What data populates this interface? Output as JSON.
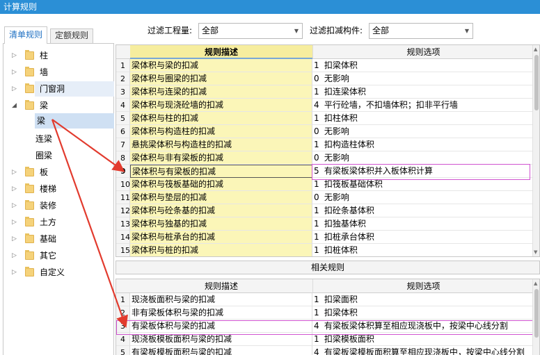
{
  "window": {
    "title": "计算规则"
  },
  "tabs": [
    {
      "label": "清单规则",
      "active": true
    },
    {
      "label": "定额规则",
      "active": false
    }
  ],
  "tree": {
    "items": [
      {
        "label": "柱",
        "expanded": false
      },
      {
        "label": "墙",
        "expanded": false
      },
      {
        "label": "门窗洞",
        "expanded": false
      },
      {
        "label": "梁",
        "expanded": true,
        "children": [
          "梁",
          "连梁",
          "圈梁"
        ]
      },
      {
        "label": "板",
        "expanded": false
      },
      {
        "label": "楼梯",
        "expanded": false
      },
      {
        "label": "装修",
        "expanded": false
      },
      {
        "label": "土方",
        "expanded": false
      },
      {
        "label": "基础",
        "expanded": false
      },
      {
        "label": "其它",
        "expanded": false
      },
      {
        "label": "自定义",
        "expanded": false
      }
    ],
    "selected_child": "梁"
  },
  "filters": {
    "quantity_label": "过滤工程量:",
    "quantity_value": "全部",
    "component_label": "过滤扣减构件:",
    "component_value": "全部"
  },
  "main_grid": {
    "headers": [
      "规则描述",
      "规则选项"
    ],
    "rows": [
      {
        "n": "1",
        "desc": "梁体积与梁的扣减",
        "code": "1",
        "opt": "扣梁体积"
      },
      {
        "n": "2",
        "desc": "梁体积与圈梁的扣减",
        "code": "0",
        "opt": "无影响"
      },
      {
        "n": "3",
        "desc": "梁体积与连梁的扣减",
        "code": "1",
        "opt": "扣连梁体积"
      },
      {
        "n": "4",
        "desc": "梁体积与现浇砼墙的扣减",
        "code": "4",
        "opt": "平行砼墙，不扣墙体积；扣非平行墙"
      },
      {
        "n": "5",
        "desc": "梁体积与柱的扣减",
        "code": "1",
        "opt": "扣柱体积"
      },
      {
        "n": "6",
        "desc": "梁体积与构造柱的扣减",
        "code": "0",
        "opt": "无影响"
      },
      {
        "n": "7",
        "desc": "悬挑梁体积与构造柱的扣减",
        "code": "1",
        "opt": "扣构造柱体积"
      },
      {
        "n": "8",
        "desc": "梁体积与非有梁板的扣减",
        "code": "0",
        "opt": "无影响"
      },
      {
        "n": "9",
        "desc": "梁体积与有梁板的扣减",
        "code": "5",
        "opt": "有梁板梁体积并入板体积计算"
      },
      {
        "n": "10",
        "desc": "梁体积与筏板基础的扣减",
        "code": "1",
        "opt": "扣筏板基础体积"
      },
      {
        "n": "11",
        "desc": "梁体积与垫层的扣减",
        "code": "0",
        "opt": "无影响"
      },
      {
        "n": "12",
        "desc": "梁体积与砼条基的扣减",
        "code": "1",
        "opt": "扣砼条基体积"
      },
      {
        "n": "13",
        "desc": "梁体积与独基的扣减",
        "code": "1",
        "opt": "扣独基体积"
      },
      {
        "n": "14",
        "desc": "梁体积与桩承台的扣减",
        "code": "1",
        "opt": "扣桩承台体积"
      },
      {
        "n": "15",
        "desc": "梁体积与桩的扣减",
        "code": "1",
        "opt": "扣桩体积"
      }
    ],
    "selected_row": "9"
  },
  "related_label": "相关规则",
  "related_grid": {
    "headers": [
      "规则描述",
      "规则选项"
    ],
    "rows": [
      {
        "n": "1",
        "desc": "现浇板面积与梁的扣减",
        "code": "1",
        "opt": "扣梁面积"
      },
      {
        "n": "2",
        "desc": "非有梁板体积与梁的扣减",
        "code": "1",
        "opt": "扣梁体积"
      },
      {
        "n": "3",
        "desc": "有梁板体积与梁的扣减",
        "code": "4",
        "opt": "有梁板梁体积算至相应现浇板中，按梁中心线分割"
      },
      {
        "n": "4",
        "desc": "现浇板模板面积与梁的扣减",
        "code": "1",
        "opt": "扣梁模板面积"
      },
      {
        "n": "5",
        "desc": "有梁板模板面积与梁的扣减",
        "code": "4",
        "opt": "有梁板梁模板面积算至相应现浇板中，按梁中心线分割"
      }
    ]
  },
  "colors": {
    "titlebar": "#2b8fd6",
    "highlight": "#d054d0",
    "arrow": "#e23b2e",
    "cell_yellow": "#fbf6b8"
  }
}
